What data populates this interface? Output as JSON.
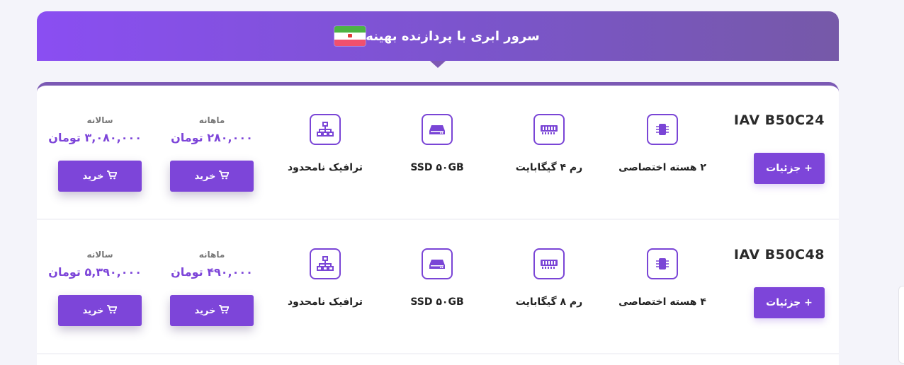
{
  "header": {
    "title": "سرور ابری با پردازنده بهینه",
    "flag_icon": "iran-flag-icon"
  },
  "colors": {
    "accent": "#7d45d9",
    "banner_start": "#8a4ef2",
    "banner_end": "#7659a8"
  },
  "plans": [
    {
      "name": "IAV B50C24",
      "details_label": "+ جزئیات",
      "cpu": "۲ هسته اختصاصی",
      "ram": "رم ۴ گیگابایت",
      "disk": "SSD ۵۰GB",
      "traffic": "ترافیک نامحدود",
      "monthly_label": "ماهانه",
      "monthly_price": "۲۸۰,۰۰۰ تومان",
      "yearly_label": "سالانه",
      "yearly_price": "۳,۰۸۰,۰۰۰ تومان",
      "buy_label": "خرید"
    },
    {
      "name": "IAV B50C48",
      "details_label": "+ جزئیات",
      "cpu": "۴ هسته اختصاصی",
      "ram": "رم ۸ گیگابایت",
      "disk": "SSD ۵۰GB",
      "traffic": "ترافیک نامحدود",
      "monthly_label": "ماهانه",
      "monthly_price": "۴۹۰,۰۰۰ تومان",
      "yearly_label": "سالانه",
      "yearly_price": "۵,۳۹۰,۰۰۰ تومان",
      "buy_label": "خرید"
    }
  ]
}
